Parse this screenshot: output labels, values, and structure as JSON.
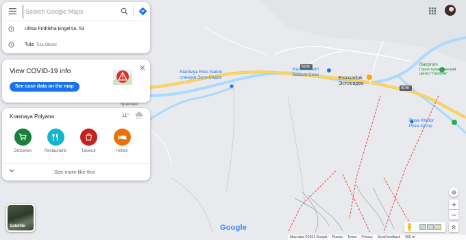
{
  "search": {
    "placeholder": "Search Google Maps"
  },
  "recent": [
    {
      "title": "Ulitsa Fridrikha Engel'sa, 53",
      "sub": ""
    },
    {
      "title": "Tula",
      "sub": "Tula Oblast"
    }
  ],
  "covid": {
    "title": "View COVID-19 info",
    "button_label": "See case data on the map"
  },
  "explore": {
    "place": "Krasnaya Polyana",
    "temperature": "11°",
    "categories": [
      {
        "label": "Groceries",
        "icon": "cart-icon",
        "color": "#188038"
      },
      {
        "label": "Restaurants",
        "icon": "fork-knife-icon",
        "color": "#12b5cb"
      },
      {
        "label": "Takeout",
        "icon": "takeout-icon",
        "color": "#c5221f"
      },
      {
        "label": "Hotels",
        "icon": "bed-icon",
        "color": "#e8710a"
      }
    ],
    "see_more": "See more like this"
  },
  "map_labels": {
    "station_en": "Stantsiya Esto-Sadok",
    "station_ru": "станция Эсто-Садок",
    "kazino": "Kazino Sochi",
    "kazino_ru": "Казино Сочи",
    "estosadok": "Estosadok",
    "estosadok_ru": "Эстосадок",
    "gazprom": "Gazprom",
    "gazprom_ru": "Горно туристический центр \"Газпром\"",
    "rosa": "Rosa Khutor",
    "rosa_ru": "Роза Хутор",
    "krasnaya": "Красная",
    "road_a148_1": "A148",
    "road_a148_2": "A148"
  },
  "satellite_label": "Satellite",
  "google_logo": "Google",
  "footer": [
    "Map data ©2021 Google",
    "Russia",
    "Terms",
    "Privacy",
    "Send feedback",
    "500 m"
  ],
  "colors": {
    "accent": "#1a73e8",
    "water": "#aadaff",
    "road": "#fdd663",
    "map_text": "#1a73e8",
    "poi_green": "#34a853",
    "poi_orange": "#f9ab00"
  }
}
